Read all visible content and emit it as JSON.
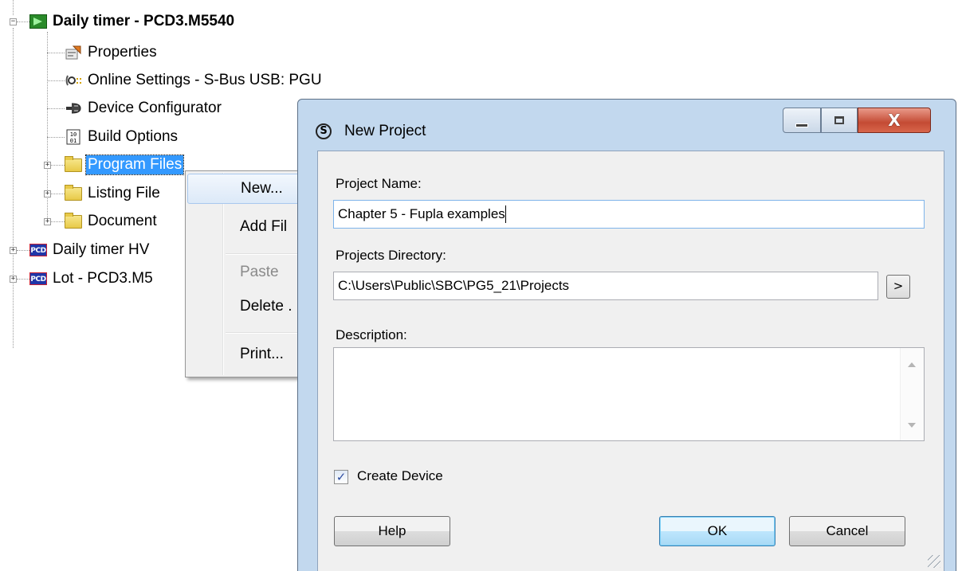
{
  "tree": {
    "device": {
      "label": "Daily timer - PCD3.M5540",
      "expander": "−"
    },
    "children": [
      {
        "label": "Properties",
        "icon": "properties-icon"
      },
      {
        "label": "Online Settings - S-Bus USB: PGU",
        "icon": "online-settings-icon"
      },
      {
        "label": "Device Configurator",
        "icon": "device-configurator-icon"
      },
      {
        "label": "Build Options",
        "icon": "build-options-icon"
      },
      {
        "label": "Program Files",
        "icon": "folder-icon",
        "selected": true,
        "expander": "+"
      },
      {
        "label": "Listing File",
        "icon": "folder-icon",
        "expander": "+"
      },
      {
        "label": "Document",
        "icon": "folder-icon",
        "expander": "+"
      }
    ],
    "other_devices": [
      {
        "label": "Daily timer HV",
        "icon_text": "PCD",
        "expander": "+"
      },
      {
        "label": "Lot - PCD3.M5",
        "icon_text": "PCD",
        "expander": "+"
      }
    ]
  },
  "context_menu": {
    "items": [
      {
        "label": "New...",
        "hover": true
      },
      {
        "label": "Add Fil"
      },
      {
        "label": "Paste",
        "disabled": true
      },
      {
        "label": "Delete ."
      },
      {
        "label": "Print..."
      }
    ]
  },
  "dialog": {
    "title": "New Project",
    "title_icon": "S",
    "close_glyph": "X",
    "project_name_label": "Project Name:",
    "project_name_value": "Chapter 5 - Fupla examples",
    "projects_directory_label": "Projects Directory:",
    "projects_directory_value": "C:\\Users\\Public\\SBC\\PG5_21\\Projects",
    "browse_label": ">",
    "description_label": "Description:",
    "description_value": "",
    "create_device_label": "Create Device",
    "create_device_checked": "✓",
    "help_label": "Help",
    "ok_label": "OK",
    "cancel_label": "Cancel"
  }
}
